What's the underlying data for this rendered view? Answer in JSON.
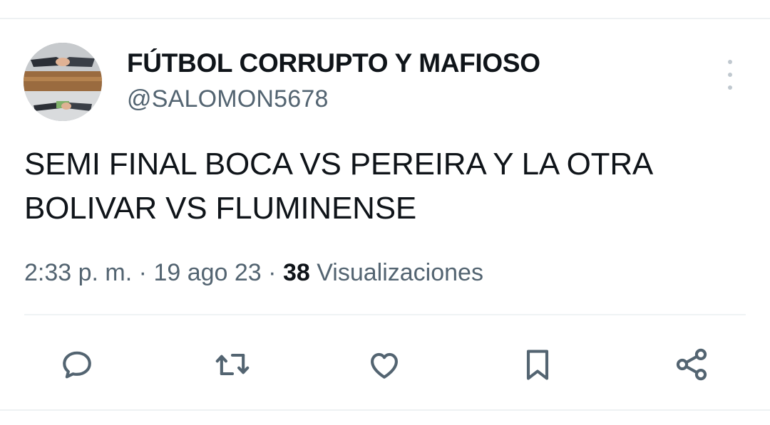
{
  "tweet": {
    "author": {
      "display_name": "FÚTBOL CORRUPTO Y MAFIOSO",
      "handle": "@SALOMON5678",
      "avatar_icon": "handshake-money-avatar"
    },
    "text_lines": [
      "SEMI FINAL BOCA VS PEREIRA Y LA OTRA",
      "BOLIVAR VS FLUMINENSE"
    ],
    "meta": {
      "time": "2:33 p. m.",
      "separator": "·",
      "date": "19 ago 23",
      "views_count": "38",
      "views_label": "Visualizaciones"
    },
    "actions": [
      {
        "name": "reply",
        "icon": "speech-bubble-icon"
      },
      {
        "name": "retweet",
        "icon": "retweet-arrows-icon"
      },
      {
        "name": "like",
        "icon": "heart-icon"
      },
      {
        "name": "bookmark",
        "icon": "bookmark-icon"
      },
      {
        "name": "share",
        "icon": "share-nodes-icon"
      }
    ]
  },
  "colors": {
    "text_primary": "#0f1419",
    "text_secondary": "#536471",
    "icon": "#536471",
    "divider": "#eff3f4"
  }
}
